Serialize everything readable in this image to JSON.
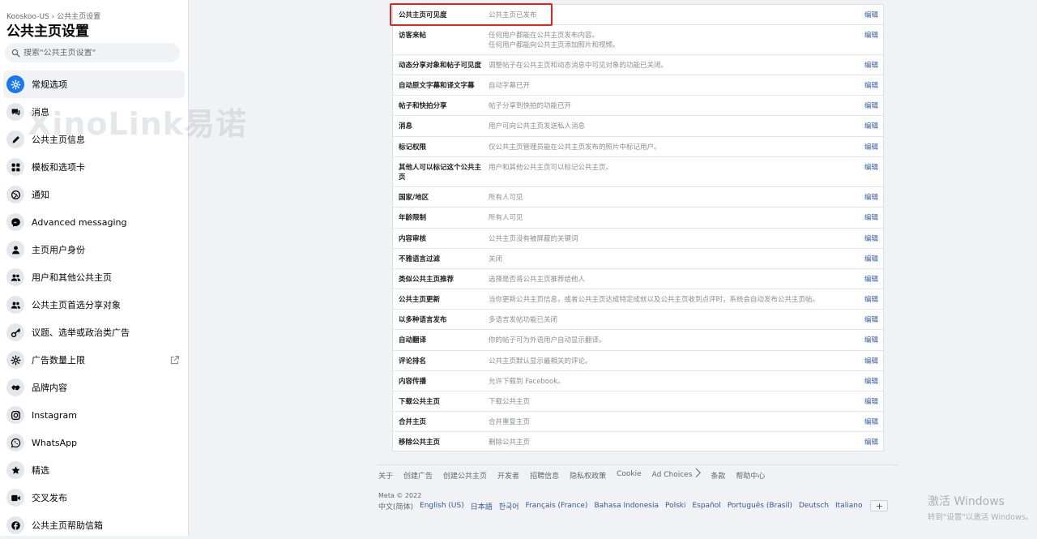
{
  "sidebar": {
    "breadcrumb": "Kooskoo-US › 公共主页设置",
    "title": "公共主页设置",
    "search_placeholder": "搜索\"公共主页设置\"",
    "items": [
      {
        "label": "常规选项",
        "icon": "gear-icon"
      },
      {
        "label": "消息",
        "icon": "chat-icon"
      },
      {
        "label": "公共主页信息",
        "icon": "pencil-icon"
      },
      {
        "label": "模板和选项卡",
        "icon": "grid-icon"
      },
      {
        "label": "通知",
        "icon": "globe-icon"
      },
      {
        "label": "Advanced messaging",
        "icon": "messenger-icon"
      },
      {
        "label": "主页用户身份",
        "icon": "person-icon"
      },
      {
        "label": "用户和其他公共主页",
        "icon": "people-icon"
      },
      {
        "label": "公共主页首选分享对象",
        "icon": "people-icon"
      },
      {
        "label": "议题、选举或政治类广告",
        "icon": "key-icon"
      },
      {
        "label": "广告数量上限",
        "icon": "gear-icon"
      },
      {
        "label": "品牌内容",
        "icon": "handshake-icon"
      },
      {
        "label": "Instagram",
        "icon": "instagram-icon"
      },
      {
        "label": "WhatsApp",
        "icon": "whatsapp-icon"
      },
      {
        "label": "精选",
        "icon": "star-icon"
      },
      {
        "label": "交叉发布",
        "icon": "video-icon"
      },
      {
        "label": "公共主页帮助信箱",
        "icon": "facebook-icon"
      }
    ]
  },
  "watermark": "XinoLink易诺",
  "settings": {
    "edit_label": "编辑",
    "rows": [
      {
        "label": "公共主页可见度",
        "value": [
          "公共主页已发布"
        ]
      },
      {
        "label": "访客来帖",
        "value": [
          "任何用户都能在公共主页发布内容。",
          "任何用户都能向公共主页添加照片和视频。"
        ]
      },
      {
        "label": "动态分享对象和帖子可见度",
        "value": [
          "调整帖子在公共主页和动态消息中可见对象的功能已关闭。"
        ]
      },
      {
        "label": "自动原文字幕和译文字幕",
        "value": [
          "自动字幕已开"
        ]
      },
      {
        "label": "帖子和快拍分享",
        "value": [
          "帖子分享到快拍的功能已开"
        ]
      },
      {
        "label": "消息",
        "value": [
          "用户可向公共主页发送私人消息"
        ]
      },
      {
        "label": "标记权限",
        "value": [
          "仅公共主页管理员能在公共主页发布的照片中标记用户。"
        ]
      },
      {
        "label": "其他人可以标记这个公共主页",
        "value": [
          "用户和其他公共主页可以标记公共主页。"
        ]
      },
      {
        "label": "国家/地区",
        "value": [
          "所有人可见"
        ]
      },
      {
        "label": "年龄限制",
        "value": [
          "所有人可见"
        ]
      },
      {
        "label": "内容审核",
        "value": [
          "公共主页没有被屏蔽的关键词"
        ]
      },
      {
        "label": "不雅语言过滤",
        "value": [
          "关闭"
        ]
      },
      {
        "label": "类似公共主页推荐",
        "value": [
          "选择是否将公共主页推荐给他人"
        ]
      },
      {
        "label": "公共主页更新",
        "value": [
          "当你更新公共主页信息，或者公共主页达成特定成就以及公共主页收到点评时，系统会自动发布公共主页帖。"
        ]
      },
      {
        "label": "以多种语言发布",
        "value": [
          "多语言发帖功能已关闭"
        ]
      },
      {
        "label": "自动翻译",
        "value": [
          "你的帖子可为外语用户自动显示翻译。"
        ]
      },
      {
        "label": "评论排名",
        "value": [
          "公共主页默认显示最相关的评论。"
        ]
      },
      {
        "label": "内容传播",
        "value": [
          "允许下载到 Facebook。"
        ]
      },
      {
        "label": "下载公共主页",
        "value": [
          "下载公共主页"
        ]
      },
      {
        "label": "合并主页",
        "value": [
          "合并重复主页"
        ]
      },
      {
        "label": "移除公共主页",
        "value": [
          "删除公共主页"
        ]
      }
    ]
  },
  "footer": {
    "links": [
      "关于",
      "创建广告",
      "创建公共主页",
      "开发者",
      "招聘信息",
      "隐私权政策",
      "Cookie",
      "Ad Choices",
      "条款",
      "帮助中心"
    ],
    "copyright": "Meta © 2022",
    "current_language": "中文(简体)",
    "languages": [
      "English (US)",
      "日本語",
      "한국어",
      "Français (France)",
      "Bahasa Indonesia",
      "Polski",
      "Español",
      "Português (Brasil)",
      "Deutsch",
      "Italiano"
    ],
    "add_label": "+"
  },
  "windows_activation": {
    "title": "激活 Windows",
    "subtitle": "转到\"设置\"以激活 Windows。"
  },
  "colors": {
    "accent": "#1877f2",
    "edit_link": "#385898",
    "highlight": "#e3231f"
  }
}
